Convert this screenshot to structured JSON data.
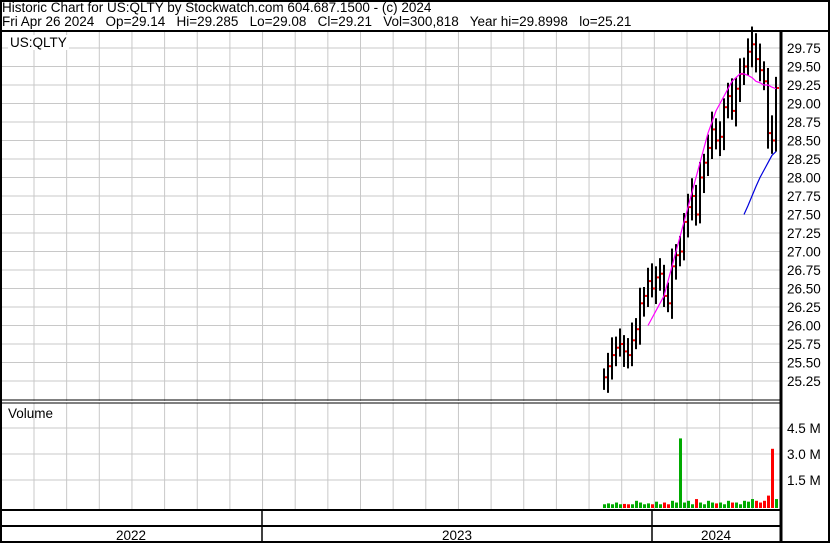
{
  "header": {
    "title": "Historic Chart for US:QLTY by Stockwatch.com 604.687.1500 - (c) 2024",
    "quote": "Fri Apr 26 2024   Op=29.14   Hi=29.285   Lo=29.08   Cl=29.21   Vol=300,818   Year hi=29.8998   lo=25.21"
  },
  "chart_data": {
    "type": "ohlc",
    "symbol": "US:QLTY",
    "volume_label": "Volume",
    "price_ticks": [
      "29.75",
      "29.50",
      "29.25",
      "29.00",
      "28.75",
      "28.50",
      "28.25",
      "28.00",
      "27.75",
      "27.50",
      "27.25",
      "27.00",
      "26.75",
      "26.50",
      "26.25",
      "26.00",
      "25.75",
      "25.50",
      "25.25"
    ],
    "ylim": [
      25.1,
      29.95
    ],
    "volume_ticks": [
      "4.5 M",
      "3.0 M",
      "1.5 M"
    ],
    "volume_ylim_millions": [
      0,
      5.5
    ],
    "year_labels": [
      "2022",
      "2023",
      "2024"
    ],
    "closes": [
      25.3,
      25.45,
      25.6,
      25.7,
      25.75,
      25.65,
      25.6,
      25.8,
      25.95,
      26.3,
      26.4,
      26.6,
      26.5,
      26.65,
      26.7,
      26.4,
      26.3,
      26.8,
      26.95,
      27.0,
      27.4,
      27.6,
      27.75,
      27.5,
      28.0,
      28.2,
      28.4,
      28.65,
      28.5,
      28.55,
      28.95,
      29.1,
      28.9,
      29.2,
      29.4,
      29.5,
      29.7,
      29.8,
      29.6,
      29.45,
      29.3,
      28.6,
      28.5,
      29.21
    ],
    "volumes_millions": [
      0.1,
      0.15,
      0.1,
      0.2,
      0.1,
      0.12,
      0.1,
      0.1,
      0.3,
      0.2,
      0.1,
      0.15,
      0.1,
      0.25,
      0.1,
      0.2,
      0.1,
      0.3,
      0.2,
      3.9,
      0.2,
      0.3,
      0.1,
      0.4,
      0.2,
      0.1,
      0.3,
      0.2,
      0.15,
      0.2,
      0.1,
      0.3,
      0.2,
      0.2,
      0.1,
      0.3,
      0.25,
      0.4,
      0.3,
      0.2,
      0.3,
      0.6,
      3.3,
      0.4
    ],
    "ma_pink": [
      null,
      null,
      null,
      null,
      null,
      null,
      null,
      null,
      null,
      null,
      null,
      26.0,
      26.1,
      26.2,
      26.3,
      26.4,
      26.6,
      26.8,
      27.0,
      27.2,
      27.4,
      27.6,
      27.8,
      28.0,
      28.2,
      28.4,
      28.6,
      28.75,
      28.9,
      29.0,
      29.1,
      29.2,
      29.3,
      29.35,
      29.4,
      29.4,
      29.38,
      29.35,
      29.3,
      29.28,
      29.25,
      29.25,
      29.22,
      29.2
    ],
    "ma_blue": [
      null,
      null,
      null,
      null,
      null,
      null,
      null,
      null,
      null,
      null,
      null,
      null,
      null,
      null,
      null,
      null,
      null,
      null,
      null,
      null,
      null,
      null,
      null,
      null,
      null,
      null,
      null,
      null,
      null,
      null,
      null,
      null,
      null,
      null,
      null,
      27.5,
      27.62,
      27.75,
      27.88,
      28.0,
      28.1,
      28.2,
      28.3,
      28.35
    ],
    "colors": {
      "up": "#00aa00",
      "down": "#ff0000",
      "ma_pink": "#ff00ff",
      "ma_blue": "#0000dd",
      "grid": "#c8c8c8"
    }
  }
}
